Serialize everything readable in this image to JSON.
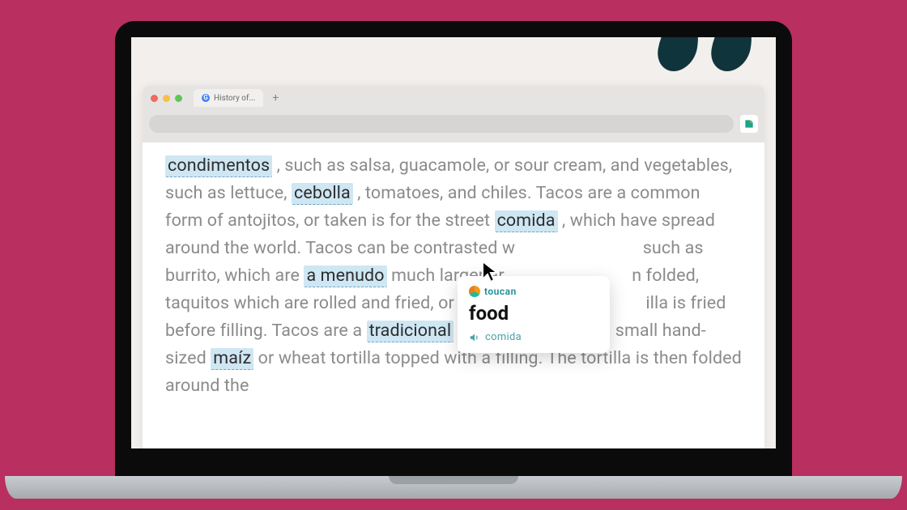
{
  "tabbar": {
    "title": "History of..."
  },
  "content": {
    "segments": [
      {
        "type": "hl",
        "text": "condimentos"
      },
      {
        "type": "txt",
        "text": " , such as salsa, guacamole, or sour cream, and vegetables, such as lettuce, "
      },
      {
        "type": "hl",
        "text": "cebolla"
      },
      {
        "type": "txt",
        "text": " , tomatoes, and chiles. Tacos are a common form of antojitos, or taken is for the street "
      },
      {
        "type": "hl",
        "text": "comida"
      },
      {
        "type": "txt",
        "text": " , which have spread around the world. Tacos can be contrasted w                             such as burrito, which are "
      },
      {
        "type": "hl",
        "text": "a menudo"
      },
      {
        "type": "txt",
        "text": " much larger ar                             n folded, taquitos which are rolled and fried, or tostada                             illa is fried before filling.  Tacos are a "
      },
      {
        "type": "hl",
        "text": "tradicional"
      },
      {
        "type": "txt",
        "text": " dish consisting of a small hand-sized "
      },
      {
        "type": "hl",
        "text": "maíz"
      },
      {
        "type": "txt",
        "text": " or wheat tortilla topped with a filling. The tortilla is then folded around the"
      }
    ]
  },
  "tooltip": {
    "brand": "toucan",
    "translation": "food",
    "original": "comida"
  }
}
